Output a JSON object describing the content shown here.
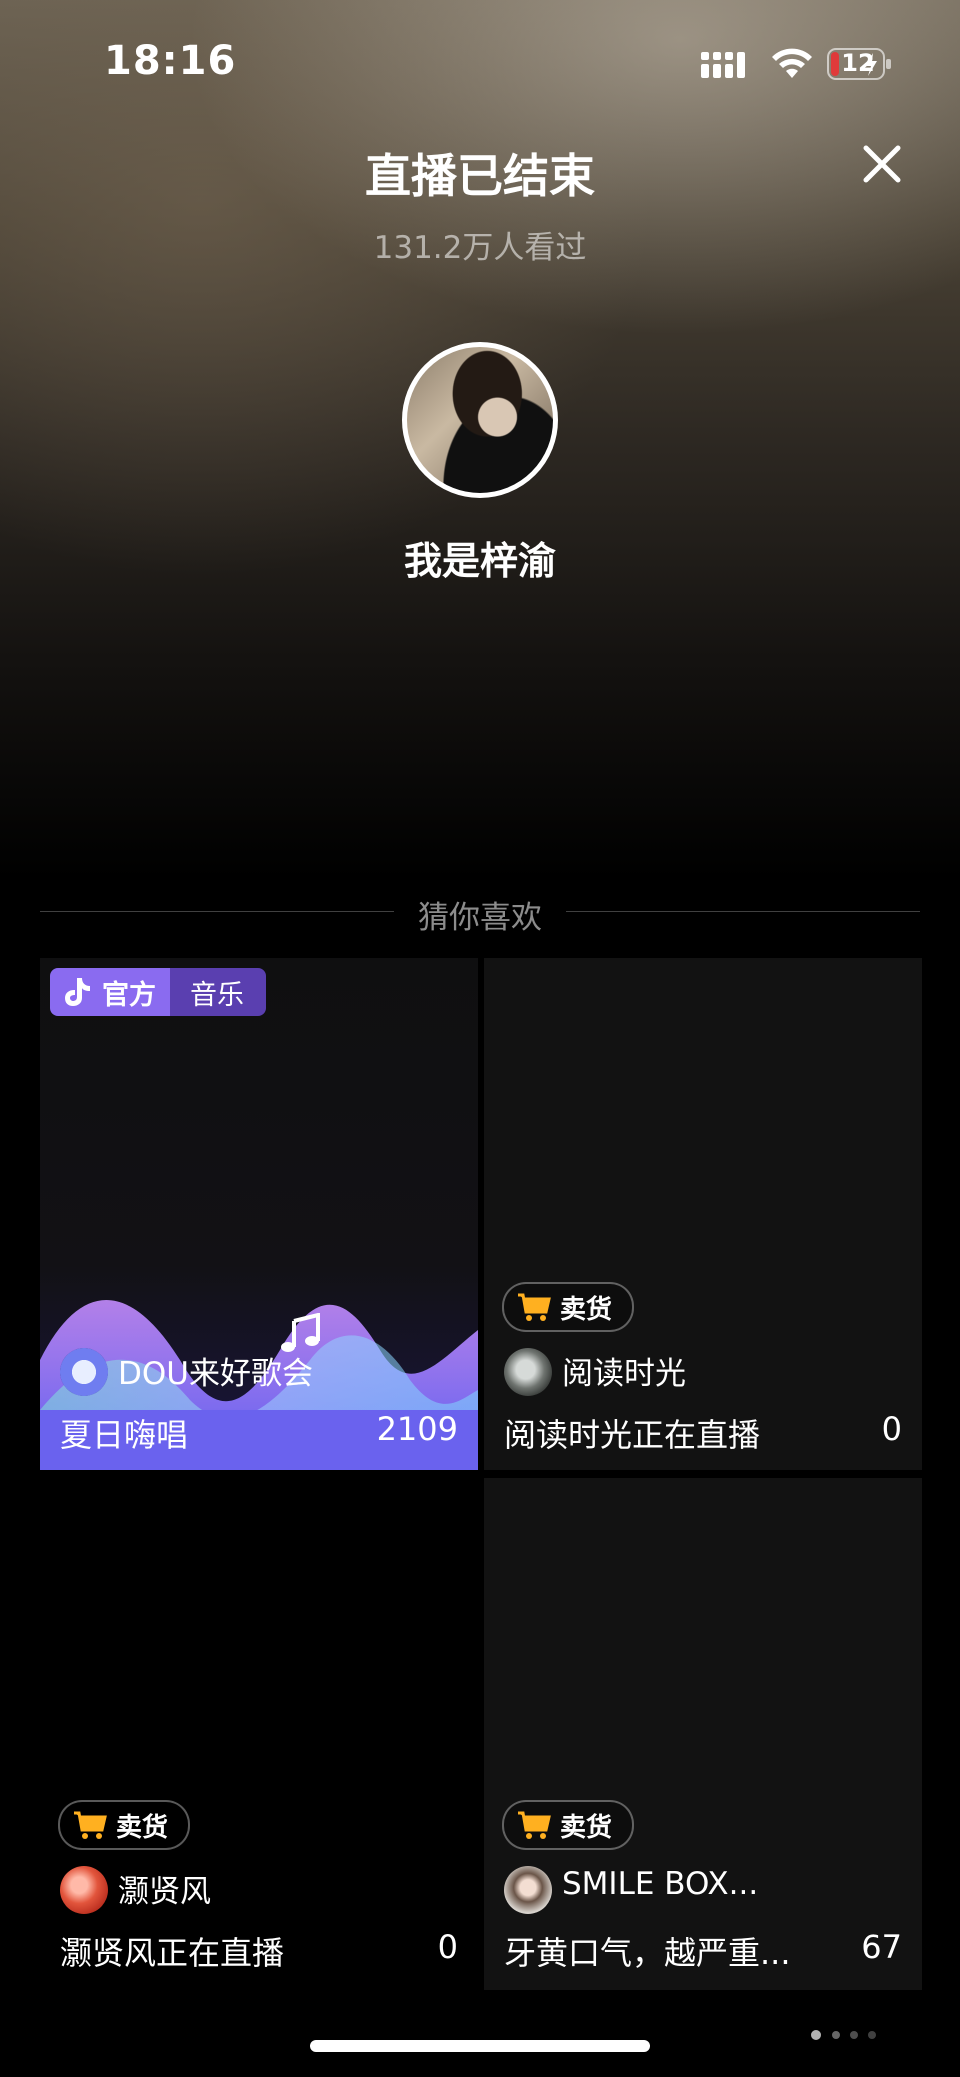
{
  "status_bar": {
    "time": "18:16",
    "battery": "12"
  },
  "header": {
    "title": "直播已结束",
    "viewers": "131.2万人看过",
    "close_icon": "close-icon"
  },
  "host": {
    "name": "我是梓渝"
  },
  "section": {
    "title": "猜你喜欢"
  },
  "cards": [
    {
      "badge_official": "官方",
      "badge_category": "音乐",
      "author": "DOU来好歌会",
      "title": "夏日嗨唱",
      "count": "2109"
    },
    {
      "badge": "卖货",
      "author": "阅读时光",
      "title": "阅读时光正在直播",
      "count": "0"
    },
    {
      "badge": "卖货",
      "author": "灏贤风",
      "title": "灏贤风正在直播",
      "count": "0"
    },
    {
      "badge": "卖货",
      "author": "SMILE BOX...",
      "title": "牙黄口气，越严重...",
      "count": "67"
    }
  ],
  "colors": {
    "official_badge": "#8a6bf0",
    "category_badge": "#5a3fb0",
    "cart_orange": "#ffb020"
  }
}
